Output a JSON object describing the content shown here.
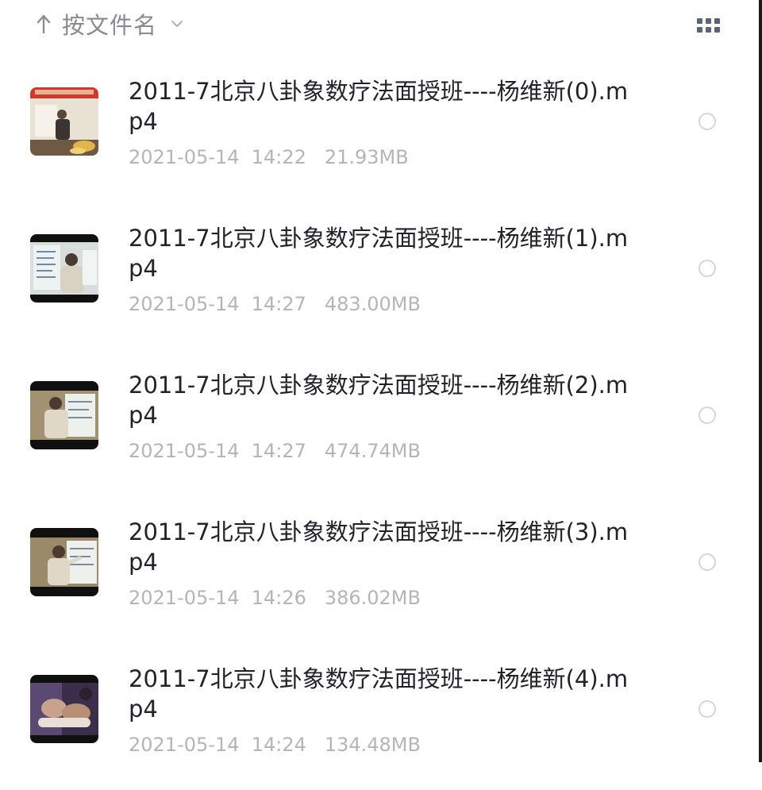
{
  "sort": {
    "label": "按文件名",
    "arrow_icon": "arrow-up-icon",
    "chevron_icon": "chevron-down-icon"
  },
  "view_toggle": {
    "icon": "grid-icon"
  },
  "files": [
    {
      "name": "2011-7北京八卦象数疗法面授班----杨维新(0).mp4",
      "date": "2021-05-14",
      "time": "14:22",
      "size": "21.93MB",
      "thumb_icon": "video-thumbnail-icon"
    },
    {
      "name": "2011-7北京八卦象数疗法面授班----杨维新(1).mp4",
      "date": "2021-05-14",
      "time": "14:27",
      "size": "483.00MB",
      "thumb_icon": "video-thumbnail-icon"
    },
    {
      "name": "2011-7北京八卦象数疗法面授班----杨维新(2).mp4",
      "date": "2021-05-14",
      "time": "14:27",
      "size": "474.74MB",
      "thumb_icon": "video-thumbnail-icon"
    },
    {
      "name": "2011-7北京八卦象数疗法面授班----杨维新(3).mp4",
      "date": "2021-05-14",
      "time": "14:26",
      "size": "386.02MB",
      "thumb_icon": "video-thumbnail-icon"
    },
    {
      "name": "2011-7北京八卦象数疗法面授班----杨维新(4).mp4",
      "date": "2021-05-14",
      "time": "14:24",
      "size": "134.48MB",
      "thumb_icon": "video-thumbnail-icon"
    }
  ],
  "colors": {
    "title_text": "#22222c",
    "meta_text": "#b4b4bc",
    "sort_text": "#8a8a92",
    "grid_icon": "#5a6478",
    "circle_border": "#d6d6da"
  }
}
